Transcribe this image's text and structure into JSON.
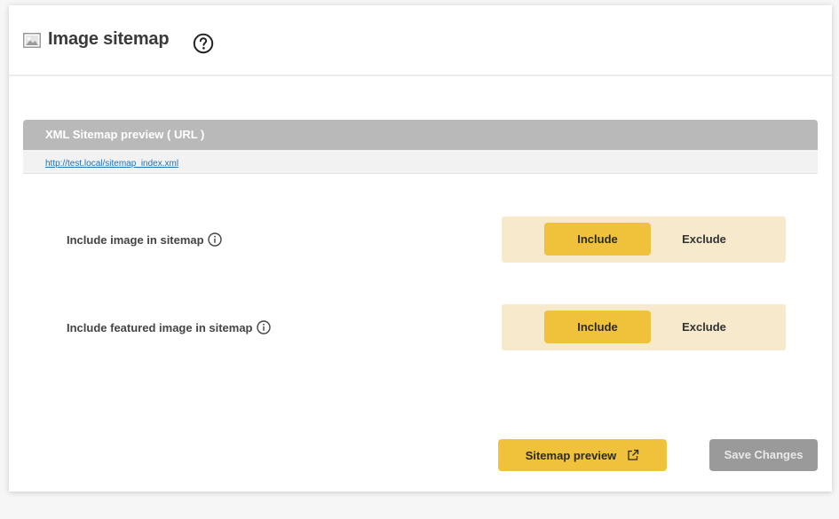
{
  "header": {
    "title": "Image sitemap",
    "icon": "image-icon",
    "help_icon": "question-circle-icon"
  },
  "preview": {
    "heading": "XML Sitemap preview ( URL )",
    "url": "http://test.local/sitemap_index.xml"
  },
  "settings": [
    {
      "label": "Include image in sitemap",
      "options": [
        "Include",
        "Exclude"
      ],
      "selected": "Include"
    },
    {
      "label": "Include featured image in sitemap",
      "options": [
        "Include",
        "Exclude"
      ],
      "selected": "Include"
    }
  ],
  "footer": {
    "preview_button": "Sitemap preview",
    "save_button": "Save Changes"
  },
  "colors": {
    "accent": "#f0c13a",
    "toggle_bg": "#f6e9cc",
    "preview_header": "#b9b9b9",
    "save_disabled": "#9a9a9a",
    "link": "#2271b1"
  }
}
